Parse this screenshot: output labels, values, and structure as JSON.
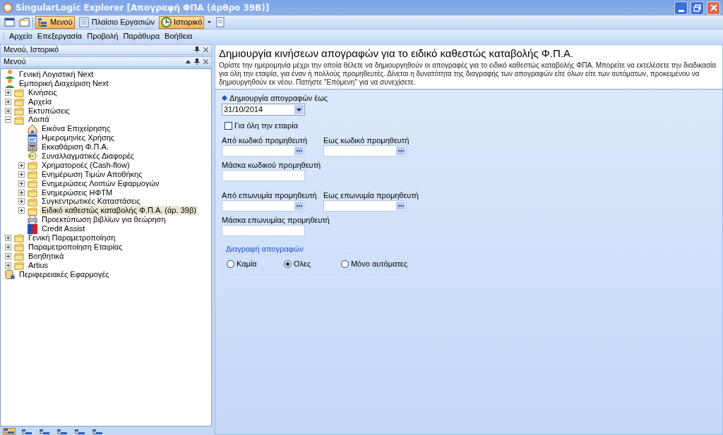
{
  "window": {
    "title": "SingularLogic Explorer [Απογραφή ΦΠΑ (άρθρο 39Β)]"
  },
  "toolbar": [
    {
      "kind": "icon",
      "selected": false
    },
    {
      "kind": "icon",
      "selected": false
    },
    {
      "kind": "separator"
    },
    {
      "kind": "button",
      "label": "Μενού",
      "selected": true
    },
    {
      "kind": "button",
      "label": "Πλαίσιο Εργασιών",
      "selected": false
    },
    {
      "kind": "button",
      "label": "Ιστορικό",
      "selected": true
    },
    {
      "kind": "dropdown"
    },
    {
      "kind": "icon",
      "selected": false
    }
  ],
  "menu": [
    "Αρχείο",
    "Επεξεργασία",
    "Προβολή",
    "Παράθυρα",
    "Βοήθεια"
  ],
  "left_panel": {
    "title": "Μενού, Ιστορικό",
    "sub_title": "Μενού",
    "tree": [
      {
        "label": "Γενική Λογιστική Next",
        "kind": "person",
        "selected": false
      },
      {
        "label": "Εμπορική Διαχείριση Next",
        "kind": "person",
        "selected": false
      },
      {
        "label": "Κινήσεις",
        "kind": "folder",
        "expanded": false,
        "selected": false
      },
      {
        "label": "Αρχεία",
        "kind": "folder",
        "expanded": false,
        "selected": false
      },
      {
        "label": "Εκτυπώσεις",
        "kind": "folder",
        "expanded": false,
        "selected": false
      },
      {
        "label": "Λοιπά",
        "kind": "folder",
        "expanded": true,
        "selected": false,
        "children": [
          {
            "label": "Εικόνα Επιχείρησης",
            "kind": "house",
            "selected": false
          },
          {
            "label": "Ημερομηνίες Χρήσης",
            "kind": "calendar",
            "selected": false
          },
          {
            "label": "Εκκαθάριση Φ.Π.Α.",
            "kind": "calculator",
            "selected": false
          },
          {
            "label": "Συναλλαγματικές Διαφορές",
            "kind": "currency",
            "selected": false
          },
          {
            "label": "Χρηματοροές (Cash-flow)",
            "kind": "folder",
            "expanded": false,
            "selected": false
          },
          {
            "label": "Ενημέρωση Τιμών Αποθήκης",
            "kind": "folder",
            "expanded": false,
            "selected": false
          },
          {
            "label": "Ενημερώσεις Λοιπών Εφαρμογών",
            "kind": "folder",
            "expanded": false,
            "selected": false
          },
          {
            "label": "Ενημερώσεις ΗΦΤΜ",
            "kind": "folder",
            "expanded": false,
            "selected": false
          },
          {
            "label": "Συγκεντρωτικές Καταστάσεις",
            "kind": "folder",
            "expanded": false,
            "selected": false
          },
          {
            "label": "Ειδικό καθεστώς καταβολής Φ.Π.Α. (άρ. 39β)",
            "kind": "folder",
            "expanded": false,
            "selected": true
          },
          {
            "label": "Προεκτύπωση βιβλίων για θεώρηση",
            "kind": "printer",
            "selected": false
          },
          {
            "label": "Credit Assist",
            "kind": "badge",
            "selected": false
          }
        ]
      },
      {
        "label": "Γενική Παραμετροποίηση",
        "kind": "folder",
        "expanded": false,
        "selected": false
      },
      {
        "label": "Παραμετροποίηση Εταιρίας",
        "kind": "folder",
        "expanded": false,
        "selected": false
      },
      {
        "label": "Βοηθητικά",
        "kind": "folder",
        "expanded": false,
        "selected": false
      },
      {
        "label": "Artius",
        "kind": "folder",
        "expanded": false,
        "selected": false
      },
      {
        "label": "Περιφερειακές Εφαρμογές",
        "kind": "database",
        "selected": false
      }
    ],
    "bottom_tabs": [
      {
        "selected": true
      },
      {
        "selected": false
      },
      {
        "selected": false
      },
      {
        "selected": false
      },
      {
        "selected": false
      },
      {
        "selected": false
      }
    ]
  },
  "content": {
    "title": "Δημιουργία κινήσεων απογραφών για το ειδικό καθεστώς καταβολής Φ.Π.Α.",
    "description": "Ορίστε την ημερομηνία μέχρι την οποία θέλετε να δημιουργηθούν οι απογραφές για το ειδικό καθεστώς καταβολής ΦΠΑ. Μπορείτε να εκτελέσετε την διαδικασία για όλη την εταιρία, για έναν ή πολλούς προμηθευτές. Δίνεται η δυνατότητα της διαγραφής των απογραφών είτε όλων είτε των αυτόματων, προκειμένου να δημιουργηθούν εκ νέου. Πατήστε \"Επόμενη\" για να συνεχίσετε.",
    "date_label": "Δημιουργία απογραφών έως",
    "date_value": "31/10/2014",
    "whole_company": {
      "label": "Για όλη την εταιρία",
      "checked": false
    },
    "rows": [
      [
        {
          "label": "Από κωδικό προμηθευτή",
          "kind": "lookup"
        },
        {
          "label": "Εως κωδικό προμηθευτή",
          "kind": "lookup"
        }
      ],
      [
        {
          "label": "Μάσκα κωδικού προμηθευτή",
          "kind": "text"
        }
      ],
      [
        {
          "label": "Από επωνυμία προμηθευτή",
          "kind": "lookup"
        },
        {
          "label": "Εως επωνυμία προμηθευτή",
          "kind": "lookup"
        }
      ],
      [
        {
          "label": "Μάσκα επωνυμίας προμηθευτή",
          "kind": "text"
        }
      ]
    ],
    "delete_group": {
      "title": "Διαγραφή απογραφών",
      "options": [
        {
          "label": "Καμία",
          "selected": false
        },
        {
          "label": "Ολες",
          "selected": true
        },
        {
          "label": "Μόνο αυτόματες",
          "selected": false
        }
      ]
    }
  }
}
